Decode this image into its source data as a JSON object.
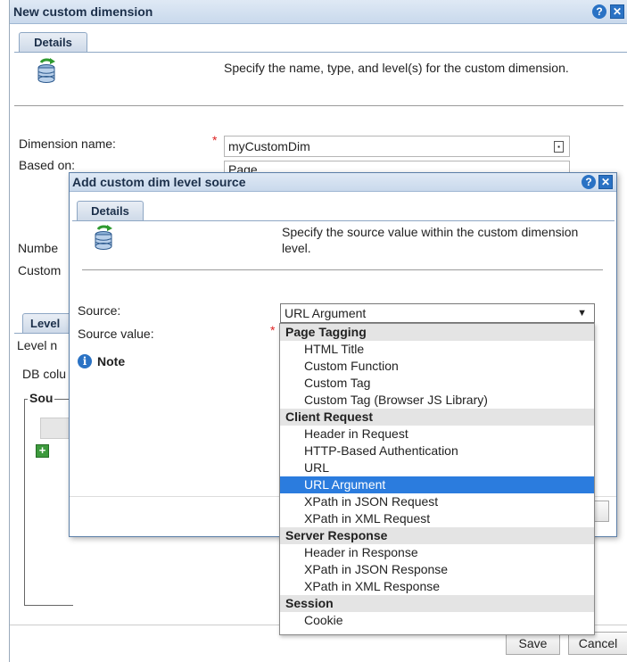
{
  "outer": {
    "title": "New custom dimension",
    "tab": "Details",
    "description": "Specify the name, type, and level(s) for the custom dimension.",
    "dimension_name_label": "Dimension name:",
    "dimension_name_value": "myCustomDim",
    "based_on_label": "Based on:",
    "based_on_value": "Page",
    "number_label": "Numbe",
    "custom_label": "Custom",
    "levels_tab": "Level",
    "level_label": "Level n",
    "db_column_label": "DB colu",
    "sources_label": "Sou",
    "save_label": "Save",
    "cancel_label": "Cancel"
  },
  "inner": {
    "title": "Add custom dim level source",
    "tab": "Details",
    "description": "Specify the source value within the custom dimension level.",
    "source_label": "Source:",
    "source_value": "URL Argument",
    "source_value_label": "Source value:",
    "note_label": "Note"
  },
  "dropdown": {
    "groups": [
      {
        "label": "Page Tagging",
        "options": [
          "HTML Title",
          "Custom Function",
          "Custom Tag",
          "Custom Tag (Browser JS Library)"
        ]
      },
      {
        "label": "Client Request",
        "options": [
          "Header in Request",
          "HTTP-Based Authentication",
          "URL",
          "URL Argument",
          "XPath in JSON Request",
          "XPath in XML Request"
        ]
      },
      {
        "label": "Server Response",
        "options": [
          "Header in Response",
          "XPath in JSON Response",
          "XPath in XML Response"
        ]
      },
      {
        "label": "Session",
        "options": [
          "Cookie"
        ]
      }
    ],
    "selected": "URL Argument"
  },
  "icons": {
    "help": "?",
    "close": "✕",
    "dropdown_arrow": "▼",
    "add": "+",
    "info": "i"
  }
}
